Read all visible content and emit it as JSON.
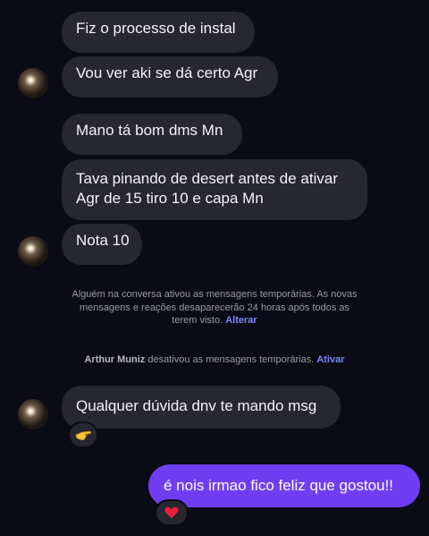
{
  "messages": {
    "m1": "Fiz o processo de instal",
    "m2": "Vou ver aki se dá certo Agr",
    "m3": "Mano tá bom dms Mn",
    "m4_line1": "Tava pinando de desert antes de ativar",
    "m4_line2": "Agr de 15 tiro 10 e capa Mn",
    "m5": "Nota 10",
    "m6": "Qualquer dúvida dnv te mando msg",
    "m7": "é nois irmao fico feliz que gostou!!"
  },
  "system": {
    "notice1_line1": "Alguém na conversa ativou as mensagens temporárias. As novas",
    "notice1_line2": "mensagens e reações desaparecerão 24 horas após todos as",
    "notice1_line3": "terem visto.",
    "notice1_link": "Alterar",
    "notice2_name": "Arthur Muniz",
    "notice2_text": "desativou as mensagens temporárias.",
    "notice2_link": "Ativar"
  },
  "reactions": {
    "r1_icon": "pointing-hand-icon",
    "r2_icon": "red-heart-icon"
  },
  "colors": {
    "background": "#0a0b14",
    "incoming_bubble": "#262730",
    "outgoing_bubble": "#6f3df2",
    "link": "#7c86ff"
  }
}
